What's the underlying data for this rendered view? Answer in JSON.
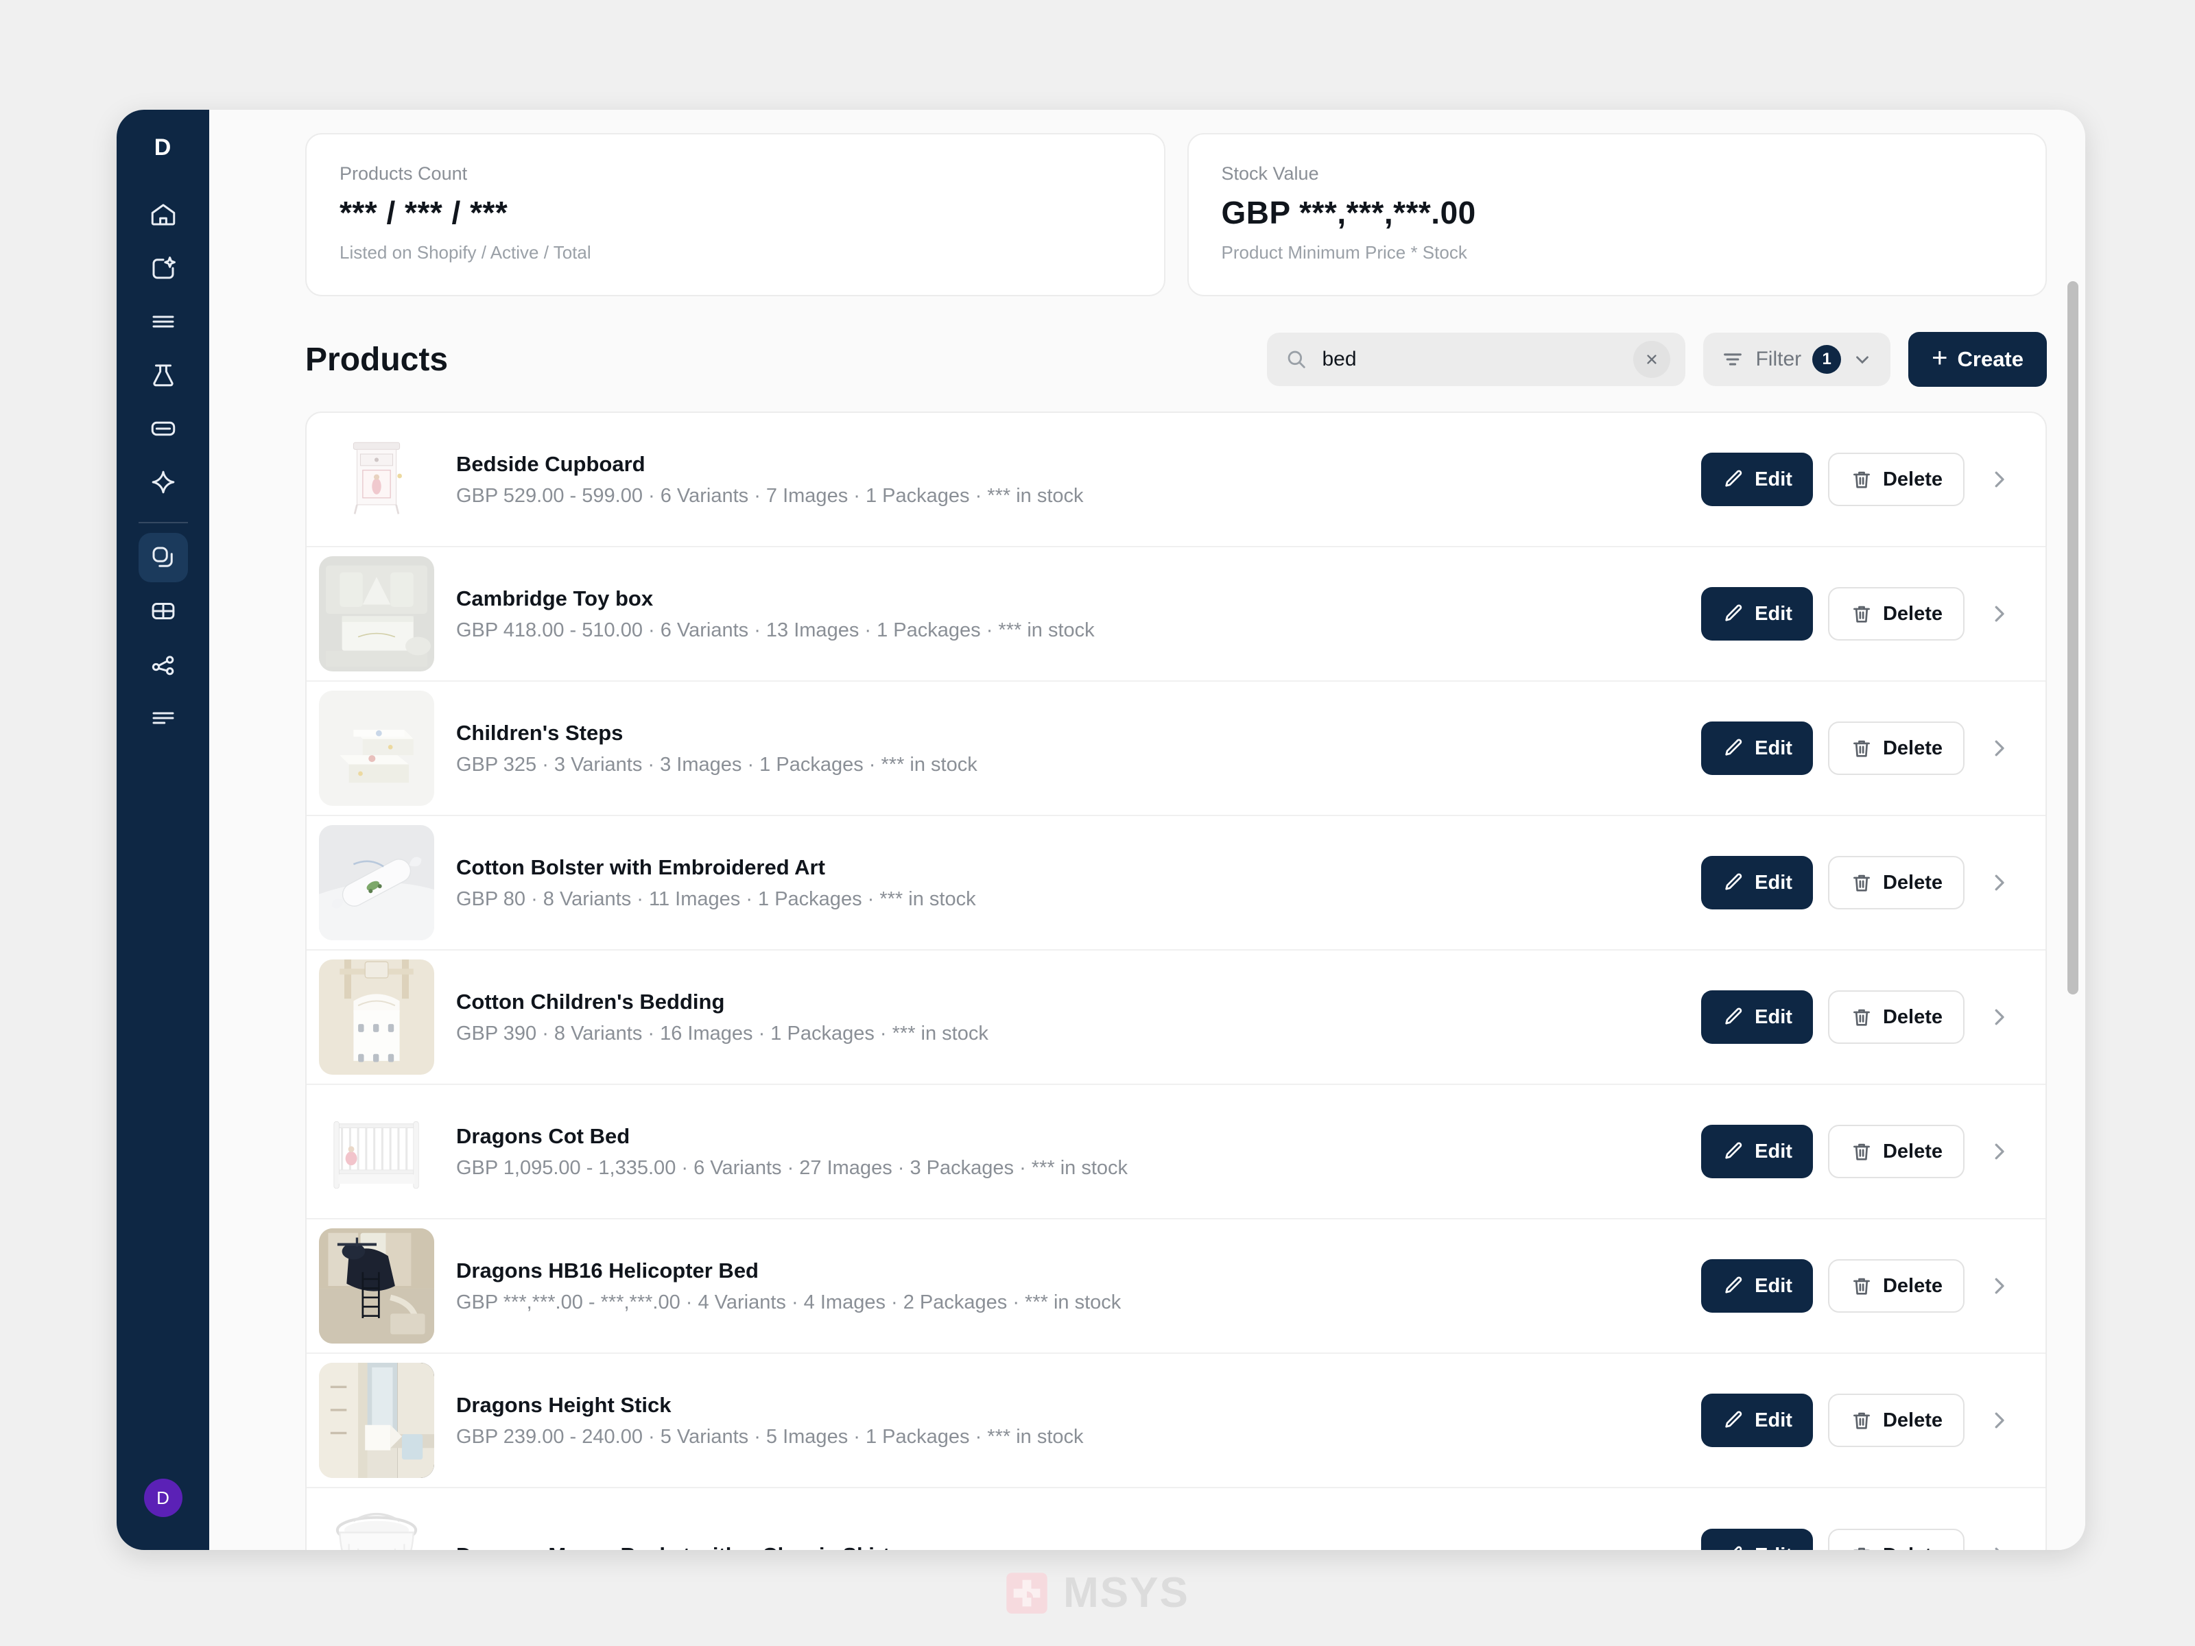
{
  "brand": {
    "mark": "D",
    "avatar_initial": "D",
    "avatar_color": "#5b21b6",
    "sidebar_color": "#0e2744"
  },
  "sidebar": {
    "items": [
      {
        "name": "home-icon",
        "label": "Home"
      },
      {
        "name": "sparkle-share-icon",
        "label": "Magic"
      },
      {
        "name": "menu-lines-icon",
        "label": "Lists"
      },
      {
        "name": "flask-icon",
        "label": "Experiments"
      },
      {
        "name": "card-icon",
        "label": "Cards"
      },
      {
        "name": "sparkle-icon",
        "label": "AI"
      },
      {
        "name": "layers-icon",
        "label": "Products"
      },
      {
        "name": "table-icon",
        "label": "Tables"
      },
      {
        "name": "share-nodes-icon",
        "label": "Integrations"
      },
      {
        "name": "text-align-icon",
        "label": "Logs"
      }
    ],
    "active_index": 6
  },
  "stats": [
    {
      "label": "Products Count",
      "value": "*** / *** / ***",
      "sub": "Listed on Shopify / Active / Total"
    },
    {
      "label": "Stock Value",
      "value": "GBP ***,***,***.00",
      "sub": "Product Minimum Price * Stock"
    }
  ],
  "toolbar": {
    "page_title": "Products",
    "search_value": "bed",
    "search_placeholder": "Search",
    "clear_label": "Clear search",
    "filter_label": "Filter",
    "filter_badge": "1",
    "create_label": "Create",
    "create_plus": "+"
  },
  "products": [
    {
      "name": "Bedside Cupboard",
      "meta": "GBP 529.00 - 599.00 · 6 Variants · 7 Images · 1 Packages · *** in stock",
      "thumb": "cupboard"
    },
    {
      "name": "Cambridge Toy box",
      "meta": "GBP 418.00 - 510.00 · 6 Variants · 13 Images · 1 Packages · *** in stock",
      "thumb": "toybox"
    },
    {
      "name": "Children's Steps",
      "meta": "GBP 325 · 3 Variants · 3 Images · 1 Packages · *** in stock",
      "thumb": "steps"
    },
    {
      "name": "Cotton Bolster with Embroidered Art",
      "meta": "GBP 80 · 8 Variants · 11 Images · 1 Packages · *** in stock",
      "thumb": "bolster"
    },
    {
      "name": "Cotton Children's Bedding",
      "meta": "GBP 390 · 8 Variants · 16 Images · 1 Packages · *** in stock",
      "thumb": "bedding"
    },
    {
      "name": "Dragons Cot Bed",
      "meta": "GBP 1,095.00 - 1,335.00 · 6 Variants · 27 Images · 3 Packages ·  *** in stock",
      "thumb": "cotbed"
    },
    {
      "name": "Dragons HB16 Helicopter Bed",
      "meta": "GBP ***,***.00 - ***,***.00 · 4 Variants · 4 Images · 2 Packages · *** in stock",
      "thumb": "helicopter"
    },
    {
      "name": "Dragons Height Stick",
      "meta": "GBP 239.00 - 240.00 · 5 Variants · 5 Images · 1 Packages · *** in stock",
      "thumb": "heightstick"
    },
    {
      "name": "Dragons Moses Basket with a Classic Skirt",
      "meta": "",
      "thumb": "basket"
    }
  ],
  "row_actions": {
    "edit_label": "Edit",
    "delete_label": "Delete"
  },
  "watermark": {
    "text": "MSYS",
    "logo_color": "#f6dade"
  }
}
